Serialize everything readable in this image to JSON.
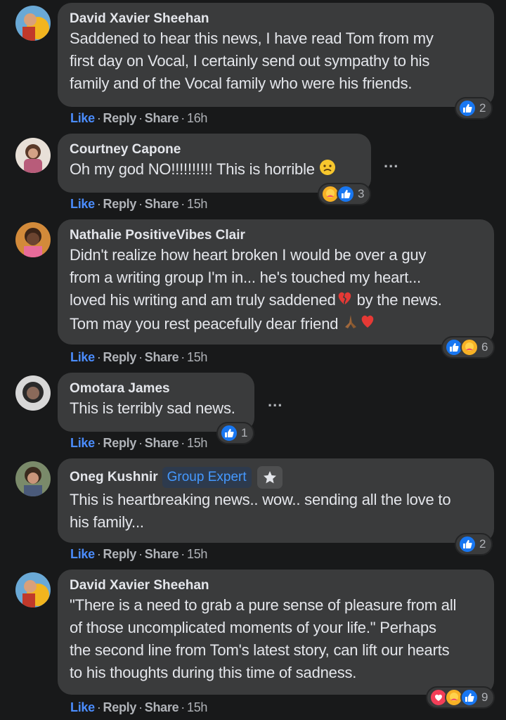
{
  "comments": [
    {
      "author": "David Xavier Sheehan",
      "lines": [
        "Saddened to hear this news, I have read Tom from my",
        "first day on Vocal, I certainly send out sympathy to his",
        "family and of the Vocal family who were his friends."
      ],
      "time": "16h",
      "reactions": [
        "like"
      ],
      "reaction_count": "2"
    },
    {
      "author": "Courtney Capone",
      "text": "Oh my god NO!!!!!!!!!! This is horrible",
      "emoji": "sad-face-icon",
      "time": "15h",
      "reactions": [
        "care",
        "like"
      ],
      "reaction_count": "3"
    },
    {
      "author": "Nathalie PositiveVibes Clair",
      "lines": [
        "Didn't realize how heart broken I would be over a guy",
        "from a writing group I'm in... he's touched my heart...",
        "loved his writing and am truly saddened",
        "by the news.",
        "Tom may you rest peacefully dear friend"
      ],
      "time": "15h",
      "reactions": [
        "like",
        "care"
      ],
      "reaction_count": "6"
    },
    {
      "author": "Omotara James",
      "text": "This is terribly sad news.",
      "time": "15h",
      "reactions": [
        "like"
      ],
      "reaction_count": "1"
    },
    {
      "author": "Oneg Kushnir",
      "badge": "Group Expert",
      "lines": [
        "This is heartbreaking news.. wow.. sending all the love to",
        "his family..."
      ],
      "time": "15h",
      "reactions": [
        "like"
      ],
      "reaction_count": "2"
    },
    {
      "author": "David Xavier Sheehan",
      "lines": [
        "\"There is a need to grab a pure sense of pleasure from all",
        "of those uncomplicated moments of your life.\" Perhaps",
        "the second line from Tom's latest story, can lift our hearts",
        "to his thoughts during this time of sadness."
      ],
      "time": "15h",
      "reactions": [
        "love",
        "care",
        "like"
      ],
      "reaction_count": "9"
    }
  ],
  "actions": {
    "like": "Like",
    "reply": "Reply",
    "share": "Share",
    "sep": "·"
  },
  "more_label": "...",
  "colors": {
    "background": "#18191a",
    "bubble": "#3a3b3c",
    "link": "#4b8dff",
    "like": "#1877f2",
    "love": "#f33e58",
    "care": "#f7b125"
  }
}
